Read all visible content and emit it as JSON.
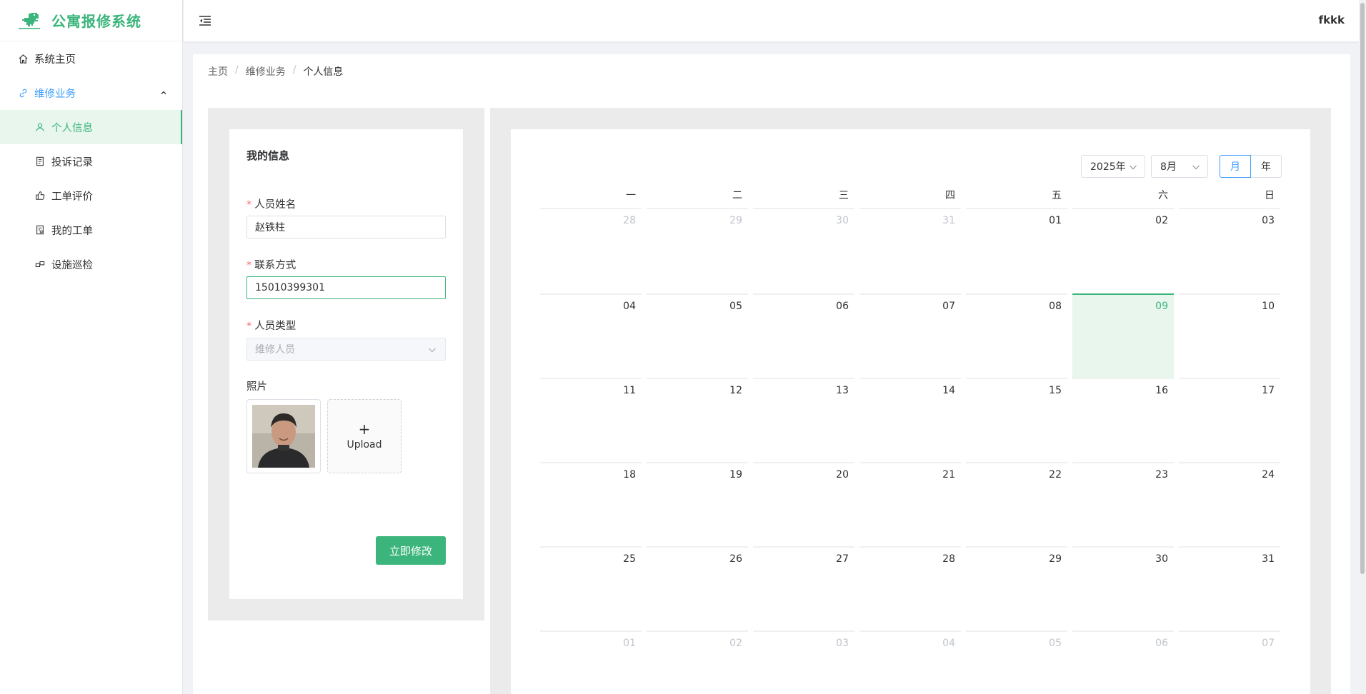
{
  "app": {
    "title": "公寓报修系统",
    "user": "fkkk"
  },
  "sidebar": {
    "items": [
      {
        "label": "系统主页",
        "icon": "home-icon"
      },
      {
        "label": "维修业务",
        "icon": "link-icon",
        "expanded": true
      },
      {
        "label": "个人信息",
        "icon": "user-icon",
        "active": true
      },
      {
        "label": "投诉记录",
        "icon": "document-icon"
      },
      {
        "label": "工单评价",
        "icon": "thumb-up-icon"
      },
      {
        "label": "我的工单",
        "icon": "tickets-icon"
      },
      {
        "label": "设施巡检",
        "icon": "inspect-icon"
      }
    ]
  },
  "breadcrumb": {
    "home": "主页",
    "section": "维修业务",
    "current": "个人信息",
    "sep": "/"
  },
  "profile": {
    "title": "我的信息",
    "name_label": "人员姓名",
    "name_value": "赵铁柱",
    "phone_label": "联系方式",
    "phone_value": "15010399301",
    "type_label": "人员类型",
    "type_placeholder": "维修人员",
    "photo_label": "照片",
    "upload_plus": "+",
    "upload_label": "Upload",
    "submit_label": "立即修改",
    "required_mark": "*"
  },
  "calendar": {
    "year_label": "2025年",
    "month_label": "8月",
    "mode_month": "月",
    "mode_year": "年",
    "weekdays": [
      "一",
      "二",
      "三",
      "四",
      "五",
      "六",
      "日"
    ],
    "weeks": [
      [
        {
          "d": "28",
          "o": true
        },
        {
          "d": "29",
          "o": true
        },
        {
          "d": "30",
          "o": true
        },
        {
          "d": "31",
          "o": true
        },
        {
          "d": "01"
        },
        {
          "d": "02"
        },
        {
          "d": "03"
        }
      ],
      [
        {
          "d": "04"
        },
        {
          "d": "05"
        },
        {
          "d": "06"
        },
        {
          "d": "07"
        },
        {
          "d": "08"
        },
        {
          "d": "09",
          "t": true
        },
        {
          "d": "10"
        }
      ],
      [
        {
          "d": "11"
        },
        {
          "d": "12"
        },
        {
          "d": "13"
        },
        {
          "d": "14"
        },
        {
          "d": "15"
        },
        {
          "d": "16"
        },
        {
          "d": "17"
        }
      ],
      [
        {
          "d": "18"
        },
        {
          "d": "19"
        },
        {
          "d": "20"
        },
        {
          "d": "21"
        },
        {
          "d": "22"
        },
        {
          "d": "23"
        },
        {
          "d": "24"
        }
      ],
      [
        {
          "d": "25"
        },
        {
          "d": "26"
        },
        {
          "d": "27"
        },
        {
          "d": "28"
        },
        {
          "d": "29"
        },
        {
          "d": "30"
        },
        {
          "d": "31"
        }
      ],
      [
        {
          "d": "01",
          "o": true
        },
        {
          "d": "02",
          "o": true
        },
        {
          "d": "03",
          "o": true
        },
        {
          "d": "04",
          "o": true
        },
        {
          "d": "05",
          "o": true
        },
        {
          "d": "06",
          "o": true
        },
        {
          "d": "07",
          "o": true
        }
      ]
    ]
  },
  "colors": {
    "brand": "#3cb57c",
    "accent": "#409eff",
    "required": "#f56c6c"
  }
}
